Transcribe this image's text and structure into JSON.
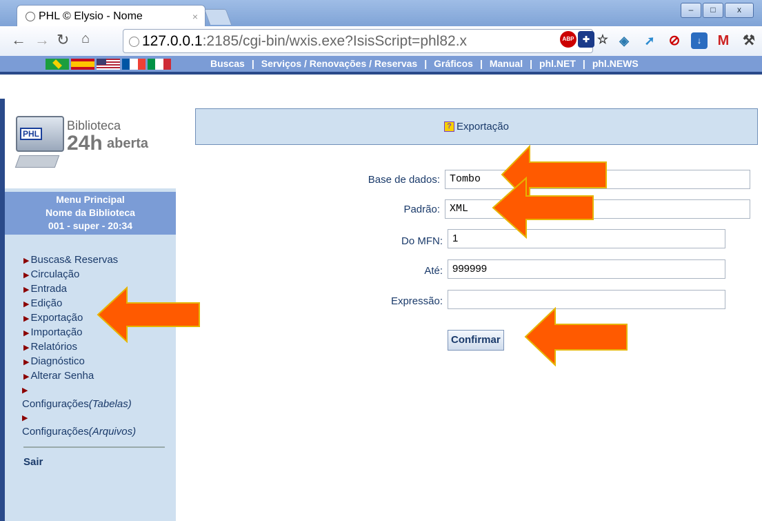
{
  "browser": {
    "tab_title": "PHL © Elysio - Nome",
    "tab_close": "×",
    "url_host": "127.0.0.1",
    "url_rest": ":2185/cgi-bin/wxis.exe?IsisScript=phl82.x",
    "win_min": "–",
    "win_max": "□",
    "win_close": "x"
  },
  "topnav": {
    "links": [
      "Buscas",
      "Serviços / Renovações / Reservas",
      "Gráficos",
      "Manual",
      "phl.NET",
      "phl.NEWS"
    ],
    "separator": "|"
  },
  "logo": {
    "line1": "Biblioteca",
    "line2": "24h",
    "line3": "aberta",
    "badge": "PHL"
  },
  "menu": {
    "head1": "Menu Principal",
    "head2": "Nome da Biblioteca",
    "head3": "001 - super - 20:34",
    "items": [
      "Buscas& Reservas",
      "Circulação",
      "Entrada",
      "Edição",
      "Exportação",
      "Importação",
      "Relatórios",
      "Diagnóstico",
      "Alterar Senha"
    ],
    "config_tabelas": "Configurações",
    "config_tabelas_em": "(Tabelas)",
    "config_arquivos": "Configurações",
    "config_arquivos_em": "(Arquivos)",
    "logout": "Sair"
  },
  "main": {
    "title": "Exportação",
    "fields": {
      "database_label": "Base de dados:",
      "database_value": "Tombo",
      "format_label": "Padrão:",
      "format_value": "XML",
      "from_label": "Do MFN:",
      "from_value": "1",
      "to_label": "Até:",
      "to_value": "999999",
      "expr_label": "Expressão:",
      "expr_value": ""
    },
    "confirm": "Confirmar"
  },
  "colors": {
    "nav_blue": "#7b9cd6",
    "sidebar": "#cfe0f0",
    "arrow": "#ff5a00"
  }
}
